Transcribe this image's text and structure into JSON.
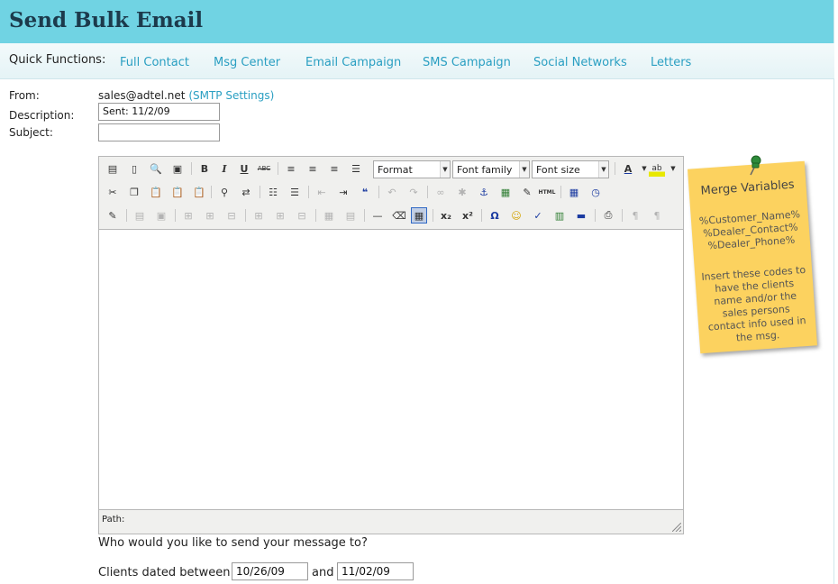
{
  "page": {
    "title": "Send Bulk Email"
  },
  "quick": {
    "label": "Quick Functions:",
    "links": [
      "Full Contact",
      "Msg Center",
      "Email Campaign",
      "SMS Campaign",
      "Social Networks",
      "Letters"
    ]
  },
  "form": {
    "from_label": "From:",
    "from_value": "sales@adtel.net",
    "smtp_link": "(SMTP Settings)",
    "description_label": "Description:",
    "description_value": "Sent: 11/2/09",
    "subject_label": "Subject:",
    "subject_value": ""
  },
  "editor": {
    "format": "Format",
    "font_family": "Font family",
    "font_size": "Font size",
    "path_label": "Path:"
  },
  "note": {
    "title": "Merge Variables",
    "variables": [
      "%Customer_Name%",
      "%Dealer_Contact%",
      "%Dealer_Phone%"
    ],
    "description": "Insert these codes to have the clients name and/or the sales persons contact info used in the msg."
  },
  "recipients": {
    "question": "Who would you like to send your message to?",
    "clients_label": "Clients dated between",
    "and_label": "and",
    "start_date": "10/26/09",
    "end_date": "11/02/09"
  },
  "colors": {
    "header": "#70d3e3",
    "link": "#2a9fc2",
    "note": "#fcd25f"
  }
}
